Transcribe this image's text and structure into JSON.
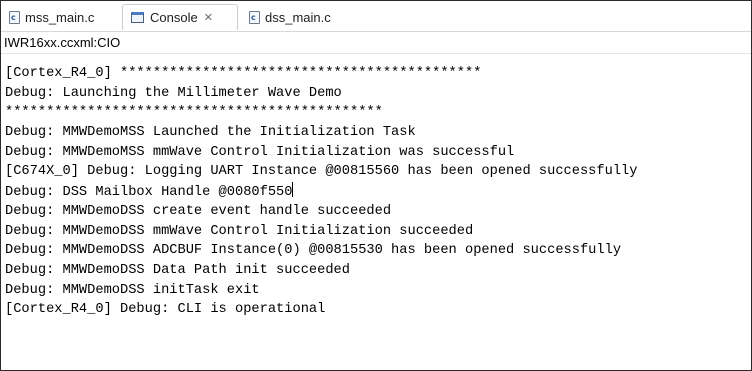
{
  "tabs": [
    {
      "label": "mss_main.c",
      "icon": "c-file-icon",
      "active": false
    },
    {
      "label": "Console",
      "icon": "console-icon",
      "active": true,
      "close_glyph": "✕"
    },
    {
      "label": "dss_main.c",
      "icon": "c-file-icon",
      "active": false
    }
  ],
  "file_icon_glyph": "c",
  "console_name": "IWR16xx.ccxml:CIO",
  "console_lines": [
    "[Cortex_R4_0] ********************************************",
    "Debug: Launching the Millimeter Wave Demo",
    "**********************************************",
    "Debug: MMWDemoMSS Launched the Initialization Task",
    "Debug: MMWDemoMSS mmWave Control Initialization was successful",
    "[C674X_0] Debug: Logging UART Instance @00815560 has been opened successfully",
    "Debug: DSS Mailbox Handle @0080f550",
    "Debug: MMWDemoDSS create event handle succeeded",
    "Debug: MMWDemoDSS mmWave Control Initialization succeeded",
    "Debug: MMWDemoDSS ADCBUF Instance(0) @00815530 has been opened successfully",
    "Debug: MMWDemoDSS Data Path init succeeded",
    "Debug: MMWDemoDSS initTask exit",
    "[Cortex_R4_0] Debug: CLI is operational"
  ]
}
